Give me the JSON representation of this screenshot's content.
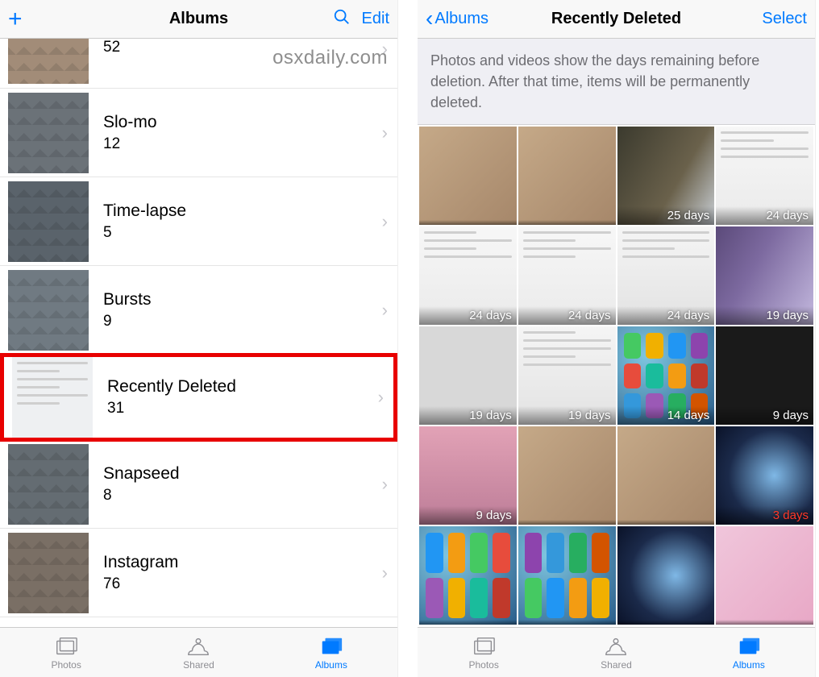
{
  "watermark": "osxdaily.com",
  "left": {
    "nav": {
      "title": "Albums",
      "edit": "Edit"
    },
    "albums": [
      {
        "name": "",
        "count": "52"
      },
      {
        "name": "Slo-mo",
        "count": "12"
      },
      {
        "name": "Time-lapse",
        "count": "5"
      },
      {
        "name": "Bursts",
        "count": "9"
      },
      {
        "name": "Recently Deleted",
        "count": "31"
      },
      {
        "name": "Snapseed",
        "count": "8"
      },
      {
        "name": "Instagram",
        "count": "76"
      }
    ]
  },
  "right": {
    "nav": {
      "back": "Albums",
      "title": "Recently Deleted",
      "select": "Select"
    },
    "banner": "Photos and videos show the days remaining before deletion. After that time, items will be permanently deleted.",
    "cells": [
      {
        "days": ""
      },
      {
        "days": ""
      },
      {
        "days": "25 days"
      },
      {
        "days": "24 days"
      },
      {
        "days": "24 days"
      },
      {
        "days": "24 days"
      },
      {
        "days": "24 days"
      },
      {
        "days": "19 days"
      },
      {
        "days": "19 days"
      },
      {
        "days": "19 days"
      },
      {
        "days": "14 days"
      },
      {
        "days": "9 days"
      },
      {
        "days": "9 days"
      },
      {
        "days": ""
      },
      {
        "days": ""
      },
      {
        "days": "3 days",
        "red": true
      },
      {
        "days": ""
      },
      {
        "days": ""
      },
      {
        "days": ""
      },
      {
        "days": ""
      }
    ]
  },
  "tabs": {
    "photos": "Photos",
    "shared": "Shared",
    "albums": "Albums"
  }
}
